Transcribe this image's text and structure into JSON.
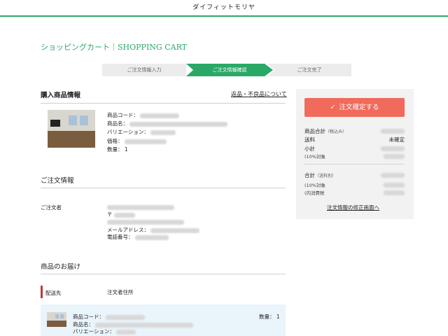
{
  "header": {
    "brand": "ダイフィットモリヤ"
  },
  "page_title": "ショッピングカート｜SHOPPING CART",
  "steps": [
    {
      "label": "ご注文情報入力",
      "active": false
    },
    {
      "label": "ご注文情報確認",
      "active": true
    },
    {
      "label": "ご注文完了",
      "active": false
    }
  ],
  "purchase": {
    "title": "購入商品情報",
    "return_link": "返品・不良品について",
    "product_code_label": "商品コード：",
    "product_name_label": "商品名：",
    "variation_label": "バリエーション：",
    "price_label": "価格：",
    "quantity_label": "数量：",
    "quantity_value": "1"
  },
  "order_info": {
    "title": "ご注文情報",
    "orderer_label": "ご注文者",
    "postal_mark": "〒",
    "email_label": "メールアドレス：",
    "phone_label": "電話番号："
  },
  "delivery": {
    "title": "商品のお届け",
    "destination_label": "配送先",
    "destination_value": "注文者住所",
    "item_code_label": "商品コード：",
    "item_name_label": "商品名：",
    "item_variation_label": "バリエーション：",
    "item_quantity": "数量： 1"
  },
  "summary": {
    "confirm_button": "注文確定する",
    "subtotal_label": "商品合計",
    "subtotal_note": "（税込み）",
    "shipping_label": "送料",
    "shipping_value": "未確定",
    "small_total_label": "小計",
    "tax_target_10": "(10%対象",
    "total_label": "合計",
    "total_note": "（送料別）",
    "tax_target_10b": "(10%対象",
    "consumption_tax": "(内消費税",
    "edit_link": "注文情報の修正画面へ"
  },
  "colors": {
    "accent": "#2aa866",
    "cta": "#f06b5b",
    "destination_bar": "#c0392b"
  }
}
